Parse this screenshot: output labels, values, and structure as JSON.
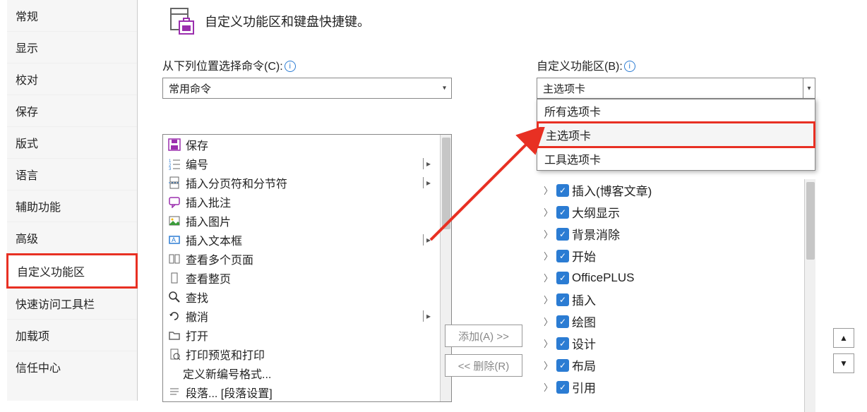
{
  "sidebar": {
    "items": [
      {
        "label": "常规"
      },
      {
        "label": "显示"
      },
      {
        "label": "校对"
      },
      {
        "label": "保存"
      },
      {
        "label": "版式"
      },
      {
        "label": "语言"
      },
      {
        "label": "辅助功能"
      },
      {
        "label": "高级"
      },
      {
        "label": "自定义功能区"
      },
      {
        "label": "快速访问工具栏"
      },
      {
        "label": "加载项"
      },
      {
        "label": "信任中心"
      }
    ]
  },
  "header": {
    "title": "自定义功能区和键盘快捷键。"
  },
  "left": {
    "section_label": "从下列位置选择命令(C):",
    "select_value": "常用命令",
    "commands": [
      {
        "icon": "save-icon",
        "label": "保存",
        "expand": false
      },
      {
        "icon": "numbering-icon",
        "label": "编号",
        "expand": true
      },
      {
        "icon": "page-break-icon",
        "label": "插入分页符和分节符",
        "expand": true
      },
      {
        "icon": "comment-icon",
        "label": "插入批注",
        "expand": false
      },
      {
        "icon": "picture-icon",
        "label": "插入图片",
        "expand": false
      },
      {
        "icon": "textbox-icon",
        "label": "插入文本框",
        "expand": true
      },
      {
        "icon": "multipage-icon",
        "label": "查看多个页面",
        "expand": false
      },
      {
        "icon": "onepage-icon",
        "label": "查看整页",
        "expand": false
      },
      {
        "icon": "find-icon",
        "label": "查找",
        "expand": false
      },
      {
        "icon": "undo-icon",
        "label": "撤消",
        "expand": true
      },
      {
        "icon": "open-icon",
        "label": "打开",
        "expand": false
      },
      {
        "icon": "print-preview-icon",
        "label": "打印预览和打印",
        "expand": false
      },
      {
        "icon": "",
        "label": "定义新编号格式...",
        "expand": false,
        "indent": true
      },
      {
        "icon": "paragraph-icon",
        "label": "段落... [段落设置]",
        "expand": false
      }
    ]
  },
  "right": {
    "section_label": "自定义功能区(B):",
    "select_value": "主选项卡",
    "dropdown": {
      "items": [
        {
          "label": "所有选项卡"
        },
        {
          "label": "主选项卡",
          "highlight": true
        },
        {
          "label": "工具选项卡"
        }
      ]
    },
    "tree": [
      {
        "label": "插入(博客文章)",
        "checked": true
      },
      {
        "label": "大纲显示",
        "checked": true
      },
      {
        "label": "背景消除",
        "checked": true
      },
      {
        "label": "开始",
        "checked": true
      },
      {
        "label": "OfficePLUS",
        "checked": true
      },
      {
        "label": "插入",
        "checked": true
      },
      {
        "label": "绘图",
        "checked": true
      },
      {
        "label": "设计",
        "checked": true
      },
      {
        "label": "布局",
        "checked": true
      },
      {
        "label": "引用",
        "checked": true
      }
    ]
  },
  "buttons": {
    "add": "添加(A) >>",
    "remove": "<< 删除(R)"
  }
}
